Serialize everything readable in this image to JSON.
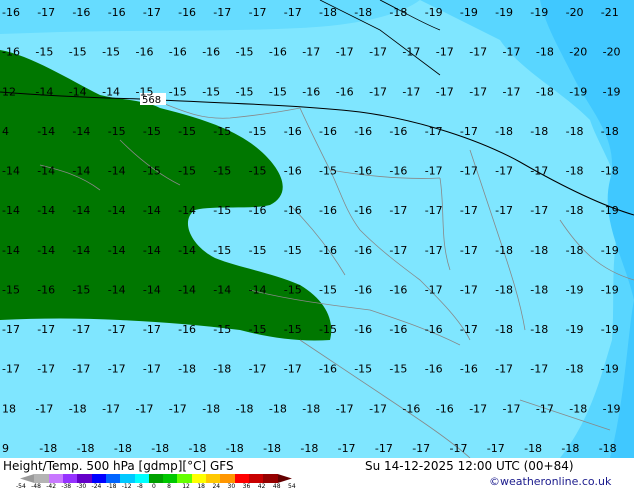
{
  "map": {
    "contour_label_568": "568",
    "colors": {
      "cyan_light": "#7fe6ff",
      "cyan": "#40d9ff",
      "blue_light": "#40c0ff",
      "green_dark": "#007700",
      "border": "#888888",
      "contour": "#000000"
    },
    "temperature_rows": [
      {
        "labels": [
          "-16",
          "-17",
          "-16",
          "-16",
          "-17",
          "-16",
          "-17",
          "-17",
          "-17",
          "-18",
          "-18",
          "-18",
          "-19",
          "-19",
          "-19",
          "-19",
          "-20",
          "-21"
        ]
      },
      {
        "labels": [
          "-16",
          "-15",
          "-15",
          "-15",
          "-16",
          "-16",
          "-16",
          "-15",
          "-16",
          "-17",
          "-17",
          "-17",
          "-17",
          "-17",
          "-17",
          "-17",
          "-18",
          "-20",
          "-20"
        ]
      },
      {
        "labels": [
          "12",
          "-14",
          "-14",
          "-14",
          "-15",
          "-15",
          "-15",
          "-15",
          "-15",
          "-16",
          "-16",
          "-17",
          "-17",
          "-17",
          "-17",
          "-17",
          "-18",
          "-19",
          "-19"
        ]
      },
      {
        "labels": [
          "4",
          "-14",
          "-14",
          "-15",
          "-15",
          "-15",
          "-15",
          "-15",
          "-16",
          "-16",
          "-16",
          "-16",
          "-17",
          "-17",
          "-18",
          "-18",
          "-18",
          "-18"
        ]
      },
      {
        "labels": [
          "-14",
          "-14",
          "-14",
          "-14",
          "-15",
          "-15",
          "-15",
          "-15",
          "-16",
          "-15",
          "-16",
          "-16",
          "-17",
          "-17",
          "-17",
          "-17",
          "-18",
          "-18"
        ]
      },
      {
        "labels": [
          "-14",
          "-14",
          "-14",
          "-14",
          "-14",
          "-14",
          "-15",
          "-16",
          "-16",
          "-16",
          "-16",
          "-17",
          "-17",
          "-17",
          "-17",
          "-17",
          "-18",
          "-19"
        ]
      },
      {
        "labels": [
          "-14",
          "-14",
          "-14",
          "-14",
          "-14",
          "-14",
          "-15",
          "-15",
          "-15",
          "-16",
          "-16",
          "-17",
          "-17",
          "-17",
          "-18",
          "-18",
          "-18",
          "-19"
        ]
      },
      {
        "labels": [
          "-15",
          "-16",
          "-15",
          "-14",
          "-14",
          "-14",
          "-14",
          "-14",
          "-15",
          "-15",
          "-16",
          "-16",
          "-17",
          "-17",
          "-18",
          "-18",
          "-19",
          "-19"
        ]
      },
      {
        "labels": [
          "-17",
          "-17",
          "-17",
          "-17",
          "-17",
          "-16",
          "-15",
          "-15",
          "-15",
          "-15",
          "-16",
          "-16",
          "-16",
          "-17",
          "-18",
          "-18",
          "-19",
          "-19"
        ]
      },
      {
        "labels": [
          "-17",
          "-17",
          "-17",
          "-17",
          "-17",
          "-18",
          "-18",
          "-17",
          "-17",
          "-16",
          "-15",
          "-15",
          "-16",
          "-16",
          "-17",
          "-17",
          "-18",
          "-19"
        ]
      },
      {
        "labels": [
          "18",
          "-17",
          "-18",
          "-17",
          "-17",
          "-17",
          "-18",
          "-18",
          "-18",
          "-18",
          "-17",
          "-17",
          "-16",
          "-16",
          "-17",
          "-17",
          "-17",
          "-18",
          "-19"
        ]
      },
      {
        "labels": [
          "9",
          "-18",
          "-18",
          "-18",
          "-18",
          "-18",
          "-18",
          "-18",
          "-18",
          "-17",
          "-17",
          "-17",
          "-17",
          "-17",
          "-18",
          "-18",
          "-18"
        ]
      }
    ]
  },
  "footer": {
    "title": "Height/Temp. 500 hPa [gdmp][°C] GFS",
    "datetime": "Su 14-12-2025 12:00 UTC (00+84)",
    "credit": "©weatheronline.co.uk",
    "scale_ticks": [
      "-54",
      "-48",
      "-42",
      "-38",
      "-30",
      "-24",
      "-18",
      "-12",
      "-8",
      "0",
      "8",
      "12",
      "18",
      "24",
      "30",
      "36",
      "42",
      "48",
      "54"
    ],
    "scale_colors": [
      "#9a9a9a",
      "#b4b4b4",
      "#c878ff",
      "#9632ff",
      "#6400c8",
      "#0000ff",
      "#0064ff",
      "#00c8ff",
      "#00ffff",
      "#00a000",
      "#00c800",
      "#64ff00",
      "#ffff00",
      "#ffc800",
      "#ff9600",
      "#ff0000",
      "#c80000",
      "#960000",
      "#640000"
    ]
  }
}
